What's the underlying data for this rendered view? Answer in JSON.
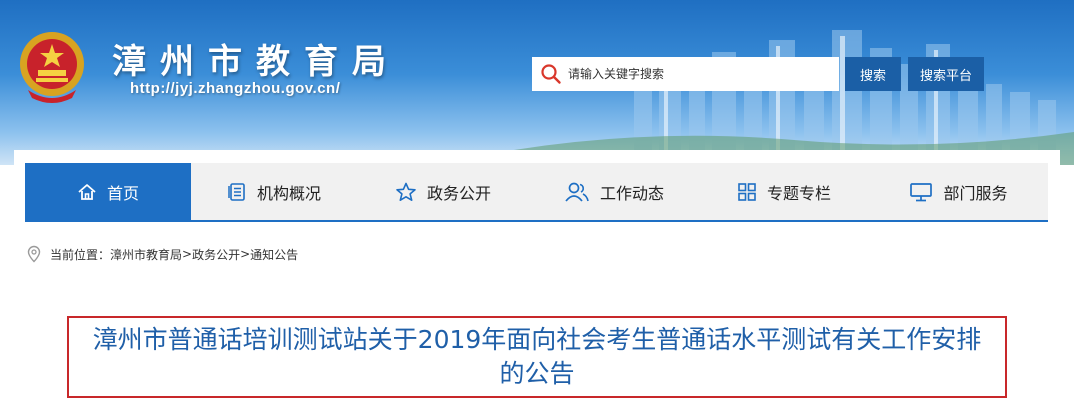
{
  "header": {
    "site_title": "漳州市教育局",
    "site_url": "http://jyj.zhangzhou.gov.cn/",
    "emblem_icon": "national-emblem-icon"
  },
  "search": {
    "placeholder": "请输入关键字搜索",
    "search_button": "搜索",
    "platform_button": "搜索平台"
  },
  "nav": {
    "items": [
      {
        "label": "首页",
        "icon": "home-icon",
        "active": true
      },
      {
        "label": "机构概况",
        "icon": "document-list-icon",
        "active": false
      },
      {
        "label": "政务公开",
        "icon": "star-icon",
        "active": false
      },
      {
        "label": "工作动态",
        "icon": "people-icon",
        "active": false
      },
      {
        "label": "专题专栏",
        "icon": "grid-icon",
        "active": false
      },
      {
        "label": "部门服务",
        "icon": "monitor-icon",
        "active": false
      }
    ]
  },
  "breadcrumb": {
    "prefix": "当前位置：",
    "items": [
      "漳州市教育局",
      "政务公开",
      "通知公告"
    ],
    "separator": ">"
  },
  "article": {
    "title": "漳州市普通话培训测试站关于2019年面向社会考生普通话水平测试有关工作安排的公告"
  },
  "colors": {
    "brand_blue": "#1e6fc4",
    "button_blue": "#1b5fa6",
    "title_blue": "#1f5fa8",
    "title_border_red": "#c8282a"
  }
}
